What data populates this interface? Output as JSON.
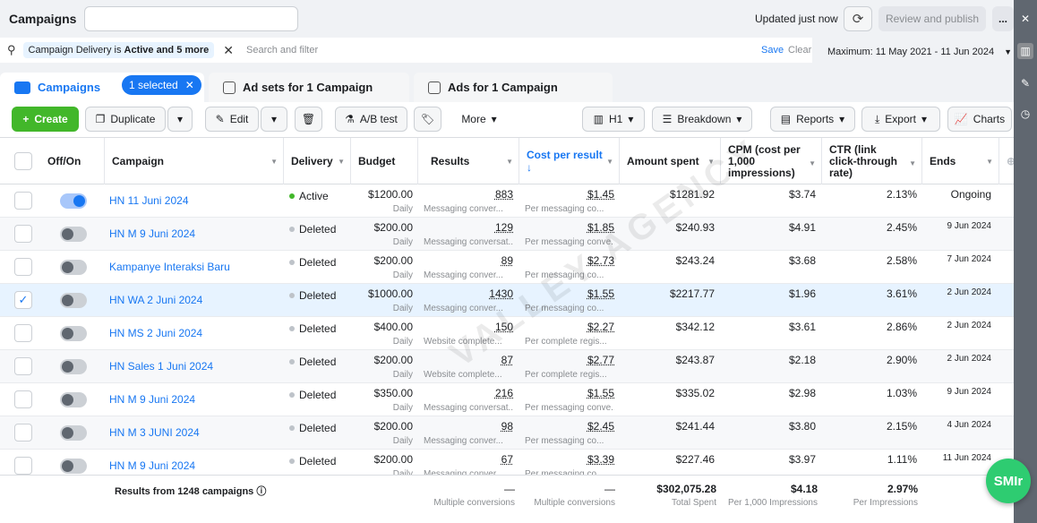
{
  "header": {
    "title": "Campaigns",
    "updated": "Updated just now",
    "review_label": "Review and publish",
    "more_label": "..."
  },
  "filter": {
    "chip_prefix": "Campaign Delivery is ",
    "chip_bold": "Active and 5 more",
    "placeholder": "Search and filter",
    "save": "Save",
    "clear": "Clear"
  },
  "date_range": "Maximum: 11 May 2021 - 11 Jun 2024",
  "tabs": {
    "campaigns": "Campaigns",
    "selected": "1 selected",
    "adsets": "Ad sets for 1 Campaign",
    "ads": "Ads for 1 Campaign"
  },
  "toolbar": {
    "create": "Create",
    "duplicate": "Duplicate",
    "edit": "Edit",
    "ab": "A/B test",
    "more": "More",
    "columns": "H1",
    "breakdown": "Breakdown",
    "reports": "Reports",
    "export": "Export",
    "charts": "Charts"
  },
  "columns": [
    "Off/On",
    "Campaign",
    "Delivery",
    "Budget",
    "Results",
    "Cost per result",
    "Amount spent",
    "CPM (cost per 1,000 impressions)",
    "CTR (link click-through rate)",
    "Ends"
  ],
  "rows": [
    {
      "on": true,
      "checked": false,
      "name": "HN 11 Juni 2024",
      "delivery": "Active",
      "budget": "$1200.00",
      "budget_sub": "Daily",
      "results": "883",
      "results_sub": "Messaging conver...",
      "cpr": "$1.45",
      "cpr_sub": "Per messaging co...",
      "spent": "$1281.92",
      "cpm": "$3.74",
      "ctr": "2.13%",
      "ends": "Ongoing"
    },
    {
      "on": false,
      "checked": false,
      "name": "HN M 9 Juni 2024",
      "delivery": "Deleted",
      "budget": "$200.00",
      "budget_sub": "Daily",
      "results": "129",
      "results_sub": "Messaging conversat...",
      "cpr": "$1.85",
      "cpr_sub": "Per messaging conve...",
      "spent": "$240.93",
      "cpm": "$4.91",
      "ctr": "2.45%",
      "ends": "9 Jun 2024"
    },
    {
      "on": false,
      "checked": false,
      "name": "Kampanye Interaksi Baru",
      "delivery": "Deleted",
      "budget": "$200.00",
      "budget_sub": "Daily",
      "results": "89",
      "results_sub": "Messaging conver...",
      "cpr": "$2.73",
      "cpr_sub": "Per messaging co...",
      "spent": "$243.24",
      "cpm": "$3.68",
      "ctr": "2.58%",
      "ends": "7 Jun 2024"
    },
    {
      "on": false,
      "checked": true,
      "name": "HN WA 2 Juni 2024",
      "delivery": "Deleted",
      "budget": "$1000.00",
      "budget_sub": "Daily",
      "results": "1430",
      "results_sub": "Messaging conver...",
      "cpr": "$1.55",
      "cpr_sub": "Per messaging co...",
      "spent": "$2217.77",
      "cpm": "$1.96",
      "ctr": "3.61%",
      "ends": "2 Jun 2024"
    },
    {
      "on": false,
      "checked": false,
      "name": "HN MS 2 Juni 2024",
      "delivery": "Deleted",
      "budget": "$400.00",
      "budget_sub": "Daily",
      "results": "150",
      "results_sub": "Website complete...",
      "cpr": "$2.27",
      "cpr_sub": "Per complete regis...",
      "spent": "$342.12",
      "cpm": "$3.61",
      "ctr": "2.86%",
      "ends": "2 Jun 2024"
    },
    {
      "on": false,
      "checked": false,
      "name": "HN Sales 1 Juni 2024",
      "delivery": "Deleted",
      "budget": "$200.00",
      "budget_sub": "Daily",
      "results": "87",
      "results_sub": "Website complete...",
      "cpr": "$2.77",
      "cpr_sub": "Per complete regis...",
      "spent": "$243.87",
      "cpm": "$2.18",
      "ctr": "2.90%",
      "ends": "2 Jun 2024"
    },
    {
      "on": false,
      "checked": false,
      "name": "HN M 9 Juni 2024",
      "delivery": "Deleted",
      "budget": "$350.00",
      "budget_sub": "Daily",
      "results": "216",
      "results_sub": "Messaging conversat...",
      "cpr": "$1.55",
      "cpr_sub": "Per messaging conve...",
      "spent": "$335.02",
      "cpm": "$2.98",
      "ctr": "1.03%",
      "ends": "9 Jun 2024"
    },
    {
      "on": false,
      "checked": false,
      "name": "HN M 3 JUNI 2024",
      "delivery": "Deleted",
      "budget": "$200.00",
      "budget_sub": "Daily",
      "results": "98",
      "results_sub": "Messaging conver...",
      "cpr": "$2.45",
      "cpr_sub": "Per messaging co...",
      "spent": "$241.44",
      "cpm": "$3.80",
      "ctr": "2.15%",
      "ends": "4 Jun 2024"
    },
    {
      "on": false,
      "checked": false,
      "name": "HN M 9 Juni 2024",
      "delivery": "Deleted",
      "budget": "$200.00",
      "budget_sub": "Daily",
      "results": "67",
      "results_sub": "Messaging conver...",
      "cpr": "$3.39",
      "cpr_sub": "Per messaging co...",
      "spent": "$227.46",
      "cpm": "$3.97",
      "ctr": "1.11%",
      "ends": "11 Jun 2024"
    }
  ],
  "footer": {
    "label": "Results from 1248 campaigns",
    "results": "—",
    "results_sub": "Multiple conversions",
    "cpr": "—",
    "cpr_sub": "Multiple conversions",
    "spent": "$302,075.28",
    "spent_sub": "Total Spent",
    "cpm": "$4.18",
    "cpm_sub": "Per 1,000 Impressions",
    "ctr": "2.97%",
    "ctr_sub": "Per Impressions"
  },
  "watermark": "VALLEY AGENCY",
  "widget": "SMIr",
  "colors": {
    "accent": "#1877f2",
    "create": "#42b72a",
    "widget": "#2ecc71"
  }
}
